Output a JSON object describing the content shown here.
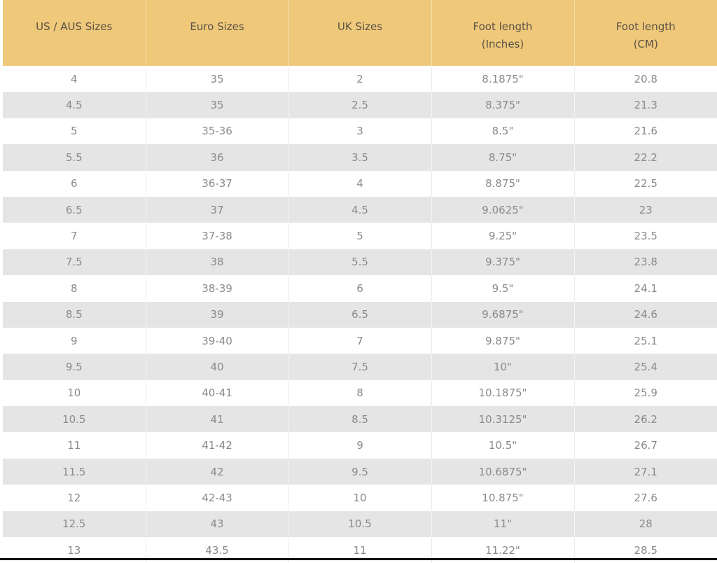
{
  "table": {
    "headers": [
      [
        "US / AUS Sizes"
      ],
      [
        "Euro Sizes"
      ],
      [
        "UK Sizes"
      ],
      [
        "Foot length",
        "(Inches)"
      ],
      [
        "Foot length",
        "(CM)"
      ]
    ],
    "rows": [
      [
        "4",
        "35",
        "2",
        "8.1875\"",
        "20.8"
      ],
      [
        "4.5",
        "35",
        "2.5",
        "8.375\"",
        "21.3"
      ],
      [
        "5",
        "35-36",
        "3",
        "8.5\"",
        "21.6"
      ],
      [
        "5.5",
        "36",
        "3.5",
        "8.75\"",
        "22.2"
      ],
      [
        "6",
        "36-37",
        "4",
        "8.875\"",
        "22.5"
      ],
      [
        "6.5",
        "37",
        "4.5",
        "9.0625\"",
        "23"
      ],
      [
        "7",
        "37-38",
        "5",
        "9.25\"",
        "23.5"
      ],
      [
        "7.5",
        "38",
        "5.5",
        "9.375\"",
        "23.8"
      ],
      [
        "8",
        "38-39",
        "6",
        "9.5\"",
        "24.1"
      ],
      [
        "8.5",
        "39",
        "6.5",
        "9.6875\"",
        "24.6"
      ],
      [
        "9",
        "39-40",
        "7",
        "9.875\"",
        "25.1"
      ],
      [
        "9.5",
        "40",
        "7.5",
        "10\"",
        "25.4"
      ],
      [
        "10",
        "40-41",
        "8",
        "10.1875\"",
        "25.9"
      ],
      [
        "10.5",
        "41",
        "8.5",
        "10.3125\"",
        "26.2"
      ],
      [
        "11",
        "41-42",
        "9",
        "10.5\"",
        "26.7"
      ],
      [
        "11.5",
        "42",
        "9.5",
        "10.6875\"",
        "27.1"
      ],
      [
        "12",
        "42-43",
        "10",
        "10.875\"",
        "27.6"
      ],
      [
        "12.5",
        "43",
        "10.5",
        "11\"",
        "28"
      ],
      [
        "13",
        "43.5",
        "11",
        "11.22\"",
        "28.5"
      ]
    ]
  }
}
